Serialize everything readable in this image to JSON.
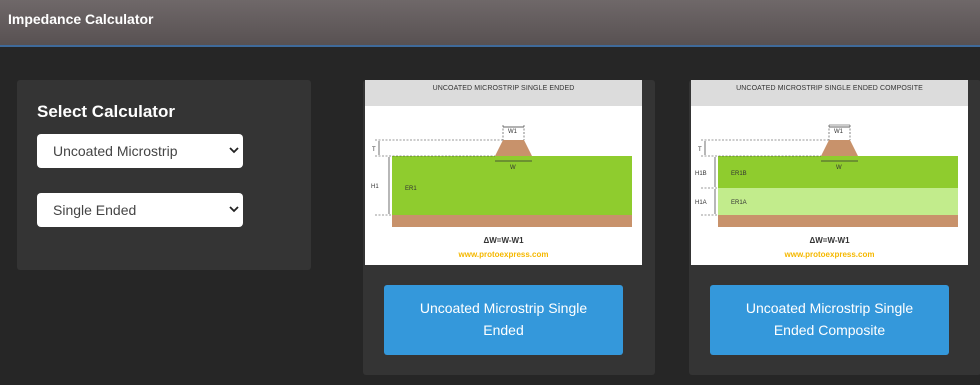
{
  "header": {
    "title": "Impedance Calculator"
  },
  "sidebar": {
    "title": "Select Calculator",
    "select_type": "Uncoated Microstrip",
    "select_mode": "Single Ended"
  },
  "cards": [
    {
      "diagram_title": "UNCOATED MICROSTRIP SINGLE ENDED",
      "labels": {
        "t": "T",
        "h1": "H1",
        "er1": "ER1",
        "w1": "W1",
        "w": "W"
      },
      "formula": "ΔW=W-W1",
      "site": "www.protoexpress.com",
      "button": "Uncoated Microstrip Single Ended"
    },
    {
      "diagram_title": "UNCOATED MICROSTRIP SINGLE ENDED COMPOSITE",
      "labels": {
        "t": "T",
        "h1b": "H1B",
        "h1a": "H1A",
        "er1b": "ER1B",
        "er1a": "ER1A",
        "w1": "W1",
        "w": "W"
      },
      "formula": "ΔW=W-W1",
      "site": "www.protoexpress.com",
      "button": "Uncoated Microstrip Single Ended Composite"
    }
  ],
  "colors": {
    "accent": "#3498db",
    "substrate": "#8fcc2e",
    "substrate_light": "#c2ec8c",
    "copper": "#c8926b",
    "site": "#f5b800"
  },
  "icons": {
    "select_arrow": "chevron-down-icon"
  }
}
